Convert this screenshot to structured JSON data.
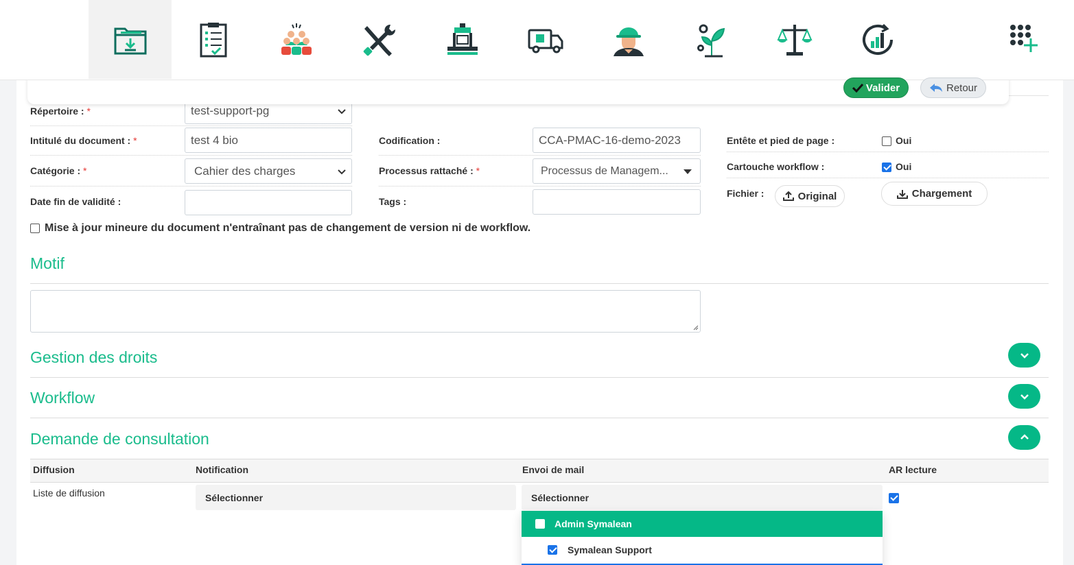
{
  "nav": {
    "icons": [
      "folder-download-icon",
      "clipboard-checklist-icon",
      "team-meeting-icon",
      "tools-wrench-screwdriver-icon",
      "machine-press-icon",
      "delivery-truck-icon",
      "worker-helmet-icon",
      "plant-gear-icon",
      "balance-scale-icon",
      "analytics-refresh-icon"
    ],
    "more_icon": "grid-plus-icon",
    "active_index": 0
  },
  "toolbar": {
    "validate_label": "Valider",
    "back_label": "Retour"
  },
  "form": {
    "repertoire_label": "Répertoire :",
    "repertoire_value": "test-support-pg",
    "intitule_label": "Intitulé du document :",
    "intitule_value": "test 4 bio",
    "categorie_label": "Catégorie :",
    "categorie_value": "Cahier des charges",
    "date_label": "Date fin de validité :",
    "date_value": "",
    "codification_label": "Codification :",
    "codification_value": "CCA-PMAC-16-demo-2023",
    "processus_label": "Processus rattaché :",
    "processus_value": "Processus de Managem...",
    "tags_label": "Tags :",
    "tags_value": "",
    "entete_label": "Entête et pied de page :",
    "entete_option": "Oui",
    "entete_checked": false,
    "cartouche_label": "Cartouche workflow :",
    "cartouche_option": "Oui",
    "cartouche_checked": true,
    "fichier_label": "Fichier :",
    "original_button": "Original",
    "chargement_button": "Chargement",
    "mise_a_jour_label": "Mise à jour mineure du document n'entraînant pas de changement de version ni de workflow.",
    "required_mark": "*"
  },
  "sections": {
    "motif": "Motif",
    "gestion_droits": "Gestion des droits",
    "workflow": "Workflow",
    "demande_consultation": "Demande de consultation"
  },
  "consultation": {
    "columns": [
      "Diffusion",
      "Notification",
      "Envoi de mail",
      "AR lecture"
    ],
    "row_label": "Liste de diffusion",
    "notification_select": "Sélectionner",
    "mail_select": "Sélectionner",
    "ar_checked": true,
    "dropdown_options": [
      {
        "label": "Admin Symalean",
        "checked": false,
        "highlighted": true
      },
      {
        "label": "Symalean Support",
        "checked": true,
        "highlighted": false
      }
    ]
  },
  "colors": {
    "accent": "#05b887",
    "section_title": "#1abc8c",
    "validate": "#22a45d",
    "checkbox": "#1a73e8",
    "required": "#e53935"
  }
}
